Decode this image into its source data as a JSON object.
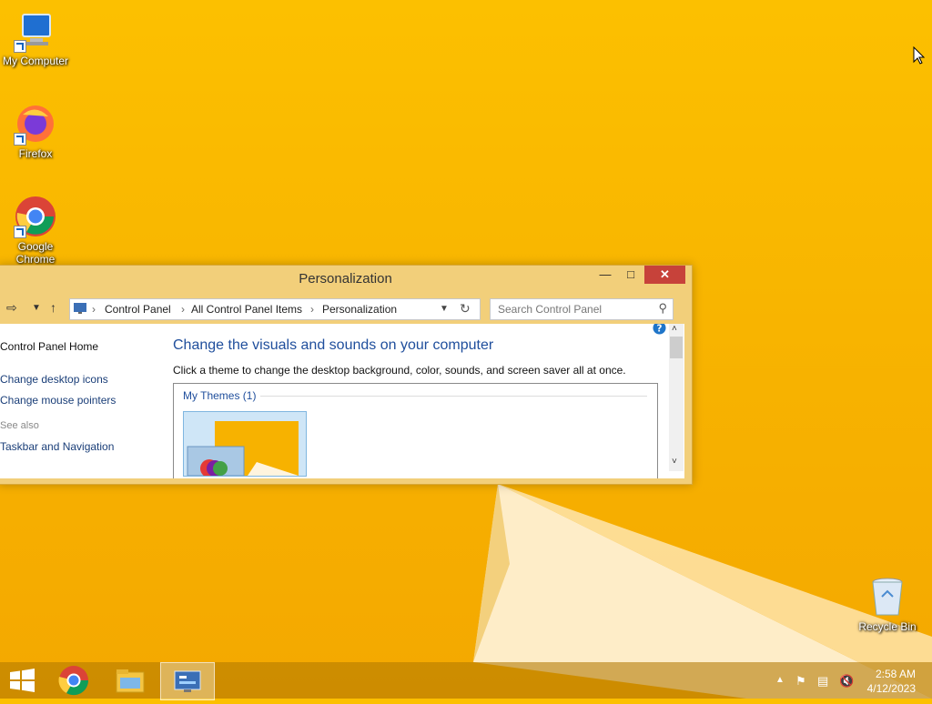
{
  "desktop": {
    "icons": [
      {
        "label": "My Computer"
      },
      {
        "label": "Firefox"
      },
      {
        "label": "Google Chrome"
      },
      {
        "label": "Recycle Bin"
      }
    ]
  },
  "window": {
    "title": "Personalization",
    "breadcrumbs": [
      "Control Panel",
      "All Control Panel Items",
      "Personalization"
    ],
    "search_placeholder": "Search Control Panel",
    "left_links": [
      "Control Panel Home",
      "Change desktop icons",
      "Change mouse pointers"
    ],
    "see_also": "See also",
    "see_also_links": [
      "Taskbar and Navigation"
    ],
    "heading": "Change the visuals and sounds on your computer",
    "subtext": "Click a theme to change the desktop background, color, sounds, and screen saver all at once.",
    "themes_group": "My Themes (1)"
  },
  "taskbar": {
    "time": "2:58 AM",
    "date": "4/12/2023",
    "items": [
      "start-button",
      "chrome",
      "file-explorer",
      "control-panel"
    ]
  },
  "colors": {
    "desktop": "#f7b200",
    "window_frame": "#f2cf7a",
    "close_button": "#c7423a",
    "link": "#1a3e78",
    "heading": "#1f4e9c"
  }
}
